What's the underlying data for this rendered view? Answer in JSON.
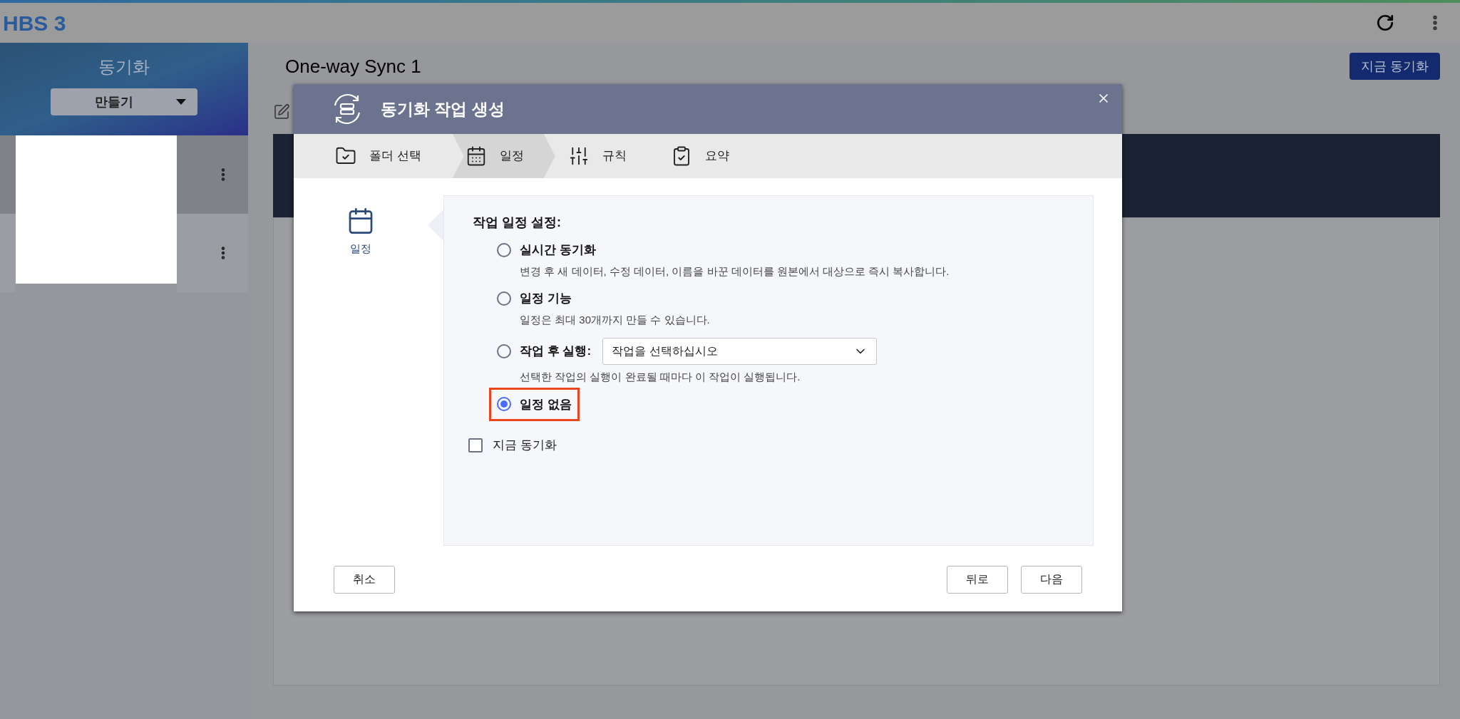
{
  "app": {
    "title": "HBS 3"
  },
  "sidebar": {
    "title": "동기화",
    "create_button": "만들기",
    "items": [
      {
        "selected": true
      },
      {
        "selected": false
      }
    ]
  },
  "main": {
    "title": "One-way Sync 1",
    "sync_now_button": "지금 동기화"
  },
  "dialog": {
    "title": "동기화 작업 생성",
    "steps": [
      {
        "label": "폴더 선택",
        "kind": "folder",
        "selected": false
      },
      {
        "label": "일정",
        "kind": "calendar",
        "selected": true
      },
      {
        "label": "규칙",
        "kind": "sliders",
        "selected": false
      },
      {
        "label": "요약",
        "kind": "clipboard",
        "selected": false
      }
    ],
    "section_label": "일정",
    "heading": "작업 일정 설정:",
    "options": [
      {
        "label": "실시간 동기화",
        "description": "변경 후 새 데이터, 수정 데이터, 이름을 바꾼 데이터를 원본에서 대상으로 즉시 복사합니다.",
        "selected": false,
        "highlighted": false
      },
      {
        "label": "일정 기능",
        "description": "일정은 최대 30개까지 만들 수 있습니다.",
        "selected": false,
        "highlighted": false
      },
      {
        "label": "작업 후 실행:",
        "select": {
          "value": "작업을 선택하십시오"
        },
        "description": "선택한 작업의 실행이 완료될 때마다 이 작업이 실행됩니다.",
        "selected": false,
        "highlighted": false
      },
      {
        "label": "일정 없음",
        "selected": true,
        "highlighted": true
      }
    ],
    "sync_now": {
      "label": "지금 동기화",
      "checked": false
    },
    "buttons": {
      "cancel": "취소",
      "back": "뒤로",
      "next": "다음"
    }
  }
}
